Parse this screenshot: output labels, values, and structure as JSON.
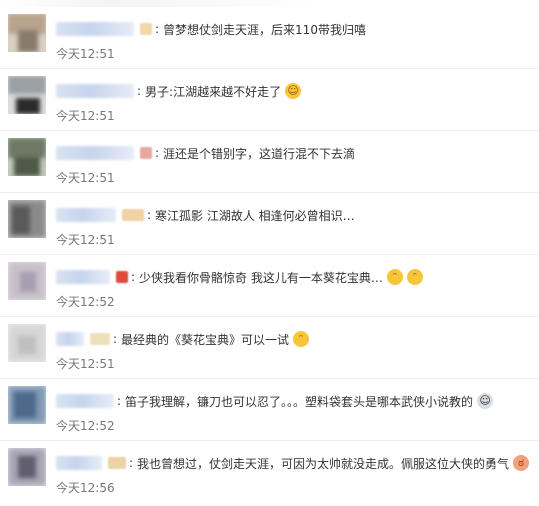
{
  "comments": [
    {
      "text": "曾梦想仗剑走天涯，后来110带我归嘻",
      "time": "今天12:51",
      "emoji": "",
      "badge_color": "#f1d8a8",
      "avatar_colors": [
        "#b9a38e",
        "#8a7a6a",
        "#d8d0c4"
      ]
    },
    {
      "text": "男子:江湖越来越不好走了",
      "time": "今天12:51",
      "emoji": "face-icon",
      "badge_color": "",
      "avatar_colors": [
        "#9aa0a4",
        "#2b2b2b",
        "#dcdcdc"
      ]
    },
    {
      "text": "涯还是个错别字，这道行混不下去滴",
      "time": "今天12:51",
      "emoji": "",
      "badge_color": "#e8a7a0",
      "avatar_colors": [
        "#6e7a66",
        "#4e5a48",
        "#c2c8bc"
      ]
    },
    {
      "text": "寒江孤影 江湖故人 相逢何必曾相识…",
      "time": "今天12:51",
      "emoji": "",
      "badge_color": "#f0d2a4",
      "avatar_colors": [
        "#5a5a5a",
        "#8a8a8a",
        "#cfcfcf"
      ]
    },
    {
      "text": "少侠我看你骨骼惊奇 我这儿有一本葵花宝典…",
      "time": "今天12:52",
      "emoji": "doge-icon doge-icon",
      "badge_color": "#e04a3a",
      "avatar_colors": [
        "#c7bfc9",
        "#a79fb0",
        "#e6e1e7"
      ]
    },
    {
      "text": "最经典的《葵花宝典》可以一试",
      "time": "今天12:51",
      "emoji": "doge-icon",
      "badge_color": "#efe0b8",
      "avatar_colors": [
        "#d6d6d6",
        "#bfbfbf",
        "#eeeeee"
      ]
    },
    {
      "text": "笛子我理解，镰刀也可以忍了。。。塑料袋套头是哪本武侠小说教的",
      "time": "今天12:52",
      "emoji": "laugh-icon",
      "badge_color": "",
      "avatar_colors": [
        "#4d6a8c",
        "#7f98b3",
        "#cfd9e3"
      ]
    },
    {
      "text": "我也曾想过，仗剑走天涯，可因为太帅就没走成。佩服这位大侠的勇气",
      "time": "今天12:56",
      "emoji": "rage-icon",
      "badge_color": "#ecd2a6",
      "avatar_colors": [
        "#5f5f6f",
        "#a9a4b3",
        "#e4e0ea"
      ]
    }
  ]
}
